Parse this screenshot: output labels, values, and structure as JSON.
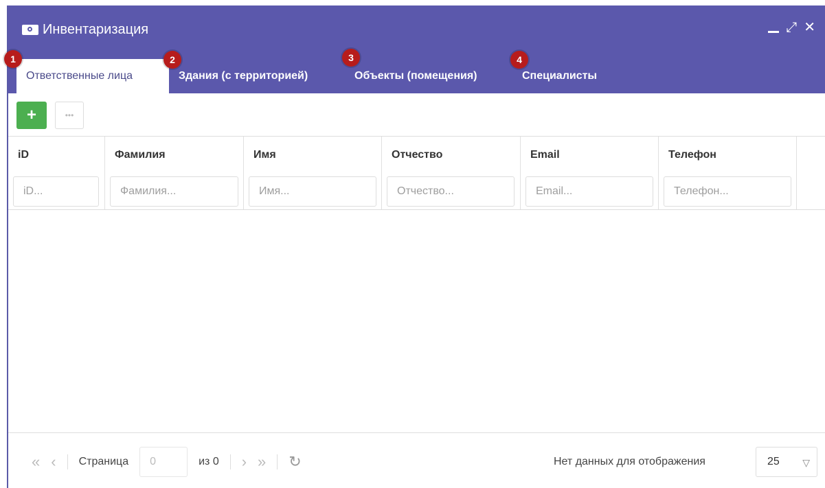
{
  "window": {
    "title": "Инвентаризация",
    "controls": [
      "minimize-icon",
      "maximize-icon",
      "close-icon"
    ]
  },
  "tabs": [
    {
      "label": "Ответственные лица",
      "badge": "1",
      "active": true
    },
    {
      "label": "Здания (с территорией)",
      "badge": "2",
      "active": false
    },
    {
      "label": "Объекты (помещения)",
      "badge": "3",
      "active": false
    },
    {
      "label": "Специалисты",
      "badge": "4",
      "active": false
    }
  ],
  "toolbar": {
    "add_label": "+",
    "more_label": "•••"
  },
  "grid": {
    "columns": [
      {
        "title": "iD",
        "placeholder": "iD..."
      },
      {
        "title": "Фамилия",
        "placeholder": "Фамилия..."
      },
      {
        "title": "Имя",
        "placeholder": "Имя..."
      },
      {
        "title": "Отчество",
        "placeholder": "Отчество..."
      },
      {
        "title": "Email",
        "placeholder": "Email..."
      },
      {
        "title": "Телефон",
        "placeholder": "Телефон..."
      }
    ]
  },
  "pager": {
    "page_label": "Страница",
    "page_value": "0",
    "of_label": "из 0",
    "status": "Нет данных для отображения",
    "page_size": "25"
  },
  "colors": {
    "header": "#5b58ac",
    "add_button": "#4caf50",
    "badge": "#b71c1c"
  }
}
